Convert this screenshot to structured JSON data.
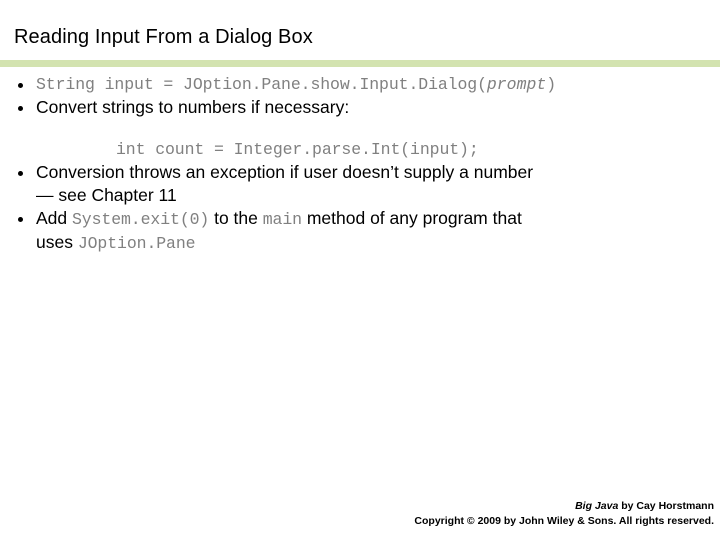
{
  "slide": {
    "title": "Reading Input From a Dialog Box",
    "bullets": {
      "b1_code_part1": "String input = JOption.Pane.show.Input.Dialog(",
      "b1_code_italic": "prompt",
      "b1_code_part2": ")",
      "b2_text": "Convert strings to numbers if necessary:",
      "b2_sub_code": "int count = Integer.parse.Int(input);",
      "b3_text_line1": "Conversion throws an exception if user doesn’t supply a number",
      "b3_text_line2": "— see Chapter 11",
      "b4_text_pre": "Add ",
      "b4_code1": "System.exit(0)",
      "b4_text_mid": " to the ",
      "b4_code2": "main",
      "b4_text_post": " method of any program that",
      "b4_text_line2_pre": "uses ",
      "b4_code3": "JOption.Pane"
    },
    "footer": {
      "book": "Big Java",
      "author": " by Cay Horstmann",
      "copyright": "Copyright © 2009 by John Wiley & Sons.  All rights reserved."
    },
    "colors": {
      "rule": "#d3e3b0",
      "code": "#808080",
      "text": "#000000",
      "background": "#ffffff"
    }
  }
}
